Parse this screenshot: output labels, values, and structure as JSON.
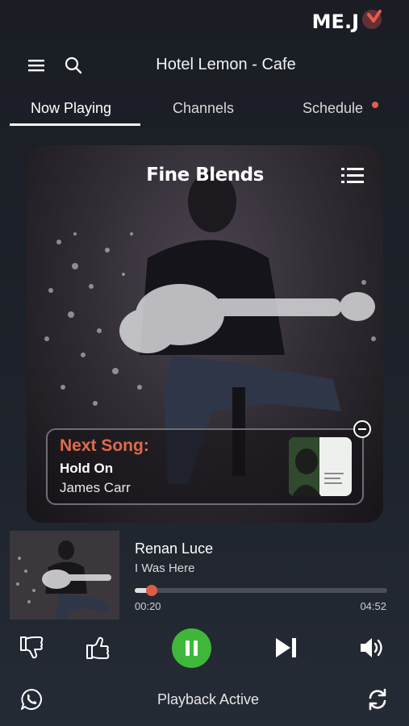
{
  "brand": {
    "logo_text": "ME.J",
    "accent": "#e85a4f"
  },
  "header": {
    "venue": "Hotel Lemon - Cafe",
    "icons": [
      "menu-icon",
      "search-icon"
    ]
  },
  "tabs": [
    {
      "label": "Now Playing",
      "active": true
    },
    {
      "label": "Channels",
      "active": false
    },
    {
      "label": "Schedule",
      "active": false,
      "has_notification": true
    }
  ],
  "channel": {
    "name": "Fine Blends"
  },
  "next_song": {
    "label": "Next Song:",
    "title": "Hold On",
    "artist": "James Carr"
  },
  "now_playing": {
    "artist": "Renan Luce",
    "song": "I Was Here",
    "elapsed": "00:20",
    "duration": "04:52",
    "progress": 0.068
  },
  "controls": [
    "thumbs-down-icon",
    "thumbs-up-icon",
    "pause-icon",
    "skip-next-icon",
    "volume-icon"
  ],
  "footer": {
    "status": "Playback Active",
    "icons": [
      "whatsapp-icon",
      "refresh-icon"
    ]
  },
  "colors": {
    "play_button": "#3fb83a",
    "next_label": "#e06a4e",
    "progress_knob": "#e05a48"
  }
}
